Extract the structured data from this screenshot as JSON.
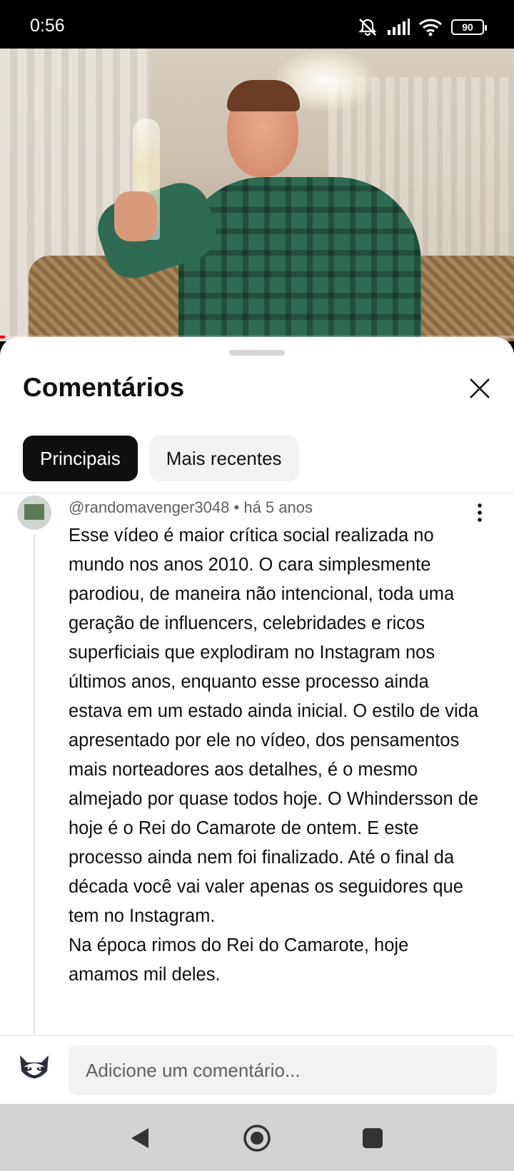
{
  "status_bar": {
    "time": "0:56",
    "battery": "90",
    "icons": [
      "mute-icon",
      "signal-icon",
      "wifi-icon",
      "battery-icon"
    ]
  },
  "video": {
    "progress_fraction": 0.01
  },
  "comments_panel": {
    "title": "Comentários",
    "tabs": [
      {
        "label": "Principais",
        "selected": true
      },
      {
        "label": "Mais recentes",
        "selected": false
      }
    ],
    "comment": {
      "author": "@randomavenger3048",
      "separator": "•",
      "time": "há 5 anos",
      "text": "Esse vídeo é maior crítica social realizada no mundo nos anos 2010. O cara simplesmente parodiou, de maneira não intencional, toda uma geração de influencers, celebridades e ricos superficiais que explodiram no Instagram nos últimos anos, enquanto esse processo ainda estava em um estado ainda inicial. O estilo de vida apresentado por ele no vídeo, dos pensamentos mais norteadores aos detalhes, é o mesmo almejado por quase todos hoje. O Whindersson de hoje é o Rei do Camarote de ontem. E este processo ainda nem foi finalizado. Até o final da década você vai valer apenas os seguidores que tem no Instagram.\nNa época rimos do Rei do Camarote, hoje amamos mil deles."
    },
    "add_comment_placeholder": "Adicione um comentário..."
  },
  "colors": {
    "chip_active_bg": "#0f0f0f",
    "chip_inactive_bg": "#f2f2f2",
    "progress": "#ff0000"
  }
}
